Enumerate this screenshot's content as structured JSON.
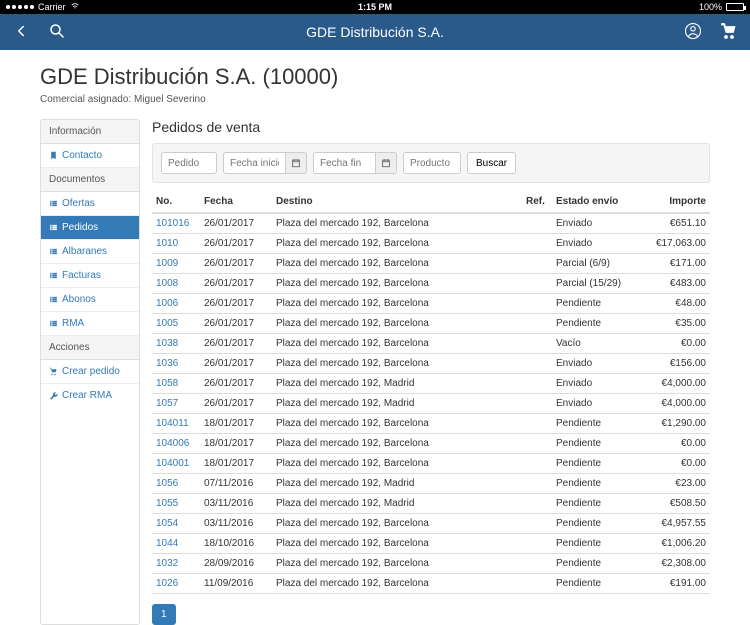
{
  "status_bar": {
    "carrier": "Carrier",
    "wifi": true,
    "time": "1:15 PM",
    "battery_pct": "100%"
  },
  "nav": {
    "title": "GDE Distribución S.A."
  },
  "header": {
    "title": "GDE Distribución S.A. (10000)",
    "subtitle_label": "Comercial asignado:",
    "subtitle_value": "Miguel Severino"
  },
  "sidebar": {
    "sections": [
      {
        "header": "Información",
        "items": [
          {
            "label": "Contacto",
            "icon": "bookmark",
            "active": false
          }
        ]
      },
      {
        "header": "Documentos",
        "items": [
          {
            "label": "Ofertas",
            "icon": "list",
            "active": false
          },
          {
            "label": "Pedidos",
            "icon": "list",
            "active": true
          },
          {
            "label": "Albaranes",
            "icon": "list",
            "active": false
          },
          {
            "label": "Facturas",
            "icon": "list",
            "active": false
          },
          {
            "label": "Abonos",
            "icon": "list",
            "active": false
          },
          {
            "label": "RMA",
            "icon": "list",
            "active": false
          }
        ]
      },
      {
        "header": "Acciones",
        "items": [
          {
            "label": "Crear pedido",
            "icon": "cart",
            "active": false
          },
          {
            "label": "Crear RMA",
            "icon": "wrench",
            "active": false
          }
        ]
      }
    ]
  },
  "main": {
    "title": "Pedidos de venta",
    "filters": {
      "pedido_ph": "Pedido",
      "fecha_inicio_ph": "Fecha inicio",
      "fecha_fin_ph": "Fecha fin",
      "producto_ph": "Producto",
      "search_btn": "Buscar"
    },
    "columns": {
      "no": "No.",
      "fecha": "Fecha",
      "destino": "Destino",
      "ref": "Ref.",
      "estado": "Estado envío",
      "importe": "Importe"
    },
    "rows": [
      {
        "no": "101016",
        "fecha": "26/01/2017",
        "destino": "Plaza del mercado 192, Barcelona",
        "ref": "",
        "estado": "Enviado",
        "importe": "€651.10"
      },
      {
        "no": "1010",
        "fecha": "26/01/2017",
        "destino": "Plaza del mercado 192, Barcelona",
        "ref": "",
        "estado": "Enviado",
        "importe": "€17,063.00"
      },
      {
        "no": "1009",
        "fecha": "26/01/2017",
        "destino": "Plaza del mercado 192, Barcelona",
        "ref": "",
        "estado": "Parcial (6/9)",
        "importe": "€171.00"
      },
      {
        "no": "1008",
        "fecha": "26/01/2017",
        "destino": "Plaza del mercado 192, Barcelona",
        "ref": "",
        "estado": "Parcial (15/29)",
        "importe": "€483.00"
      },
      {
        "no": "1006",
        "fecha": "26/01/2017",
        "destino": "Plaza del mercado 192, Barcelona",
        "ref": "",
        "estado": "Pendiente",
        "importe": "€48.00"
      },
      {
        "no": "1005",
        "fecha": "26/01/2017",
        "destino": "Plaza del mercado 192, Barcelona",
        "ref": "",
        "estado": "Pendiente",
        "importe": "€35.00"
      },
      {
        "no": "1038",
        "fecha": "26/01/2017",
        "destino": "Plaza del mercado 192, Barcelona",
        "ref": "",
        "estado": "Vacío",
        "importe": "€0.00"
      },
      {
        "no": "1036",
        "fecha": "26/01/2017",
        "destino": "Plaza del mercado 192, Barcelona",
        "ref": "",
        "estado": "Enviado",
        "importe": "€156.00"
      },
      {
        "no": "1058",
        "fecha": "26/01/2017",
        "destino": "Plaza del mercado 192, Madrid",
        "ref": "",
        "estado": "Enviado",
        "importe": "€4,000.00"
      },
      {
        "no": "1057",
        "fecha": "26/01/2017",
        "destino": "Plaza del mercado 192, Madrid",
        "ref": "",
        "estado": "Enviado",
        "importe": "€4,000.00"
      },
      {
        "no": "104011",
        "fecha": "18/01/2017",
        "destino": "Plaza del mercado 192, Barcelona",
        "ref": "",
        "estado": "Pendiente",
        "importe": "€1,290.00"
      },
      {
        "no": "104006",
        "fecha": "18/01/2017",
        "destino": "Plaza del mercado 192, Barcelona",
        "ref": "",
        "estado": "Pendiente",
        "importe": "€0.00"
      },
      {
        "no": "104001",
        "fecha": "18/01/2017",
        "destino": "Plaza del mercado 192, Barcelona",
        "ref": "",
        "estado": "Pendiente",
        "importe": "€0.00"
      },
      {
        "no": "1056",
        "fecha": "07/11/2016",
        "destino": "Plaza del mercado 192, Madrid",
        "ref": "",
        "estado": "Pendiente",
        "importe": "€23.00"
      },
      {
        "no": "1055",
        "fecha": "03/11/2016",
        "destino": "Plaza del mercado 192, Madrid",
        "ref": "",
        "estado": "Pendiente",
        "importe": "€508.50"
      },
      {
        "no": "1054",
        "fecha": "03/11/2016",
        "destino": "Plaza del mercado 192, Barcelona",
        "ref": "",
        "estado": "Pendiente",
        "importe": "€4,957.55"
      },
      {
        "no": "1044",
        "fecha": "18/10/2016",
        "destino": "Plaza del mercado 192, Barcelona",
        "ref": "",
        "estado": "Pendiente",
        "importe": "€1,006.20"
      },
      {
        "no": "1032",
        "fecha": "28/09/2016",
        "destino": "Plaza del mercado 192, Barcelona",
        "ref": "",
        "estado": "Pendiente",
        "importe": "€2,308.00"
      },
      {
        "no": "1026",
        "fecha": "11/09/2016",
        "destino": "Plaza del mercado 192, Barcelona",
        "ref": "",
        "estado": "Pendiente",
        "importe": "€191.00"
      }
    ],
    "pagination": {
      "current": "1"
    }
  }
}
